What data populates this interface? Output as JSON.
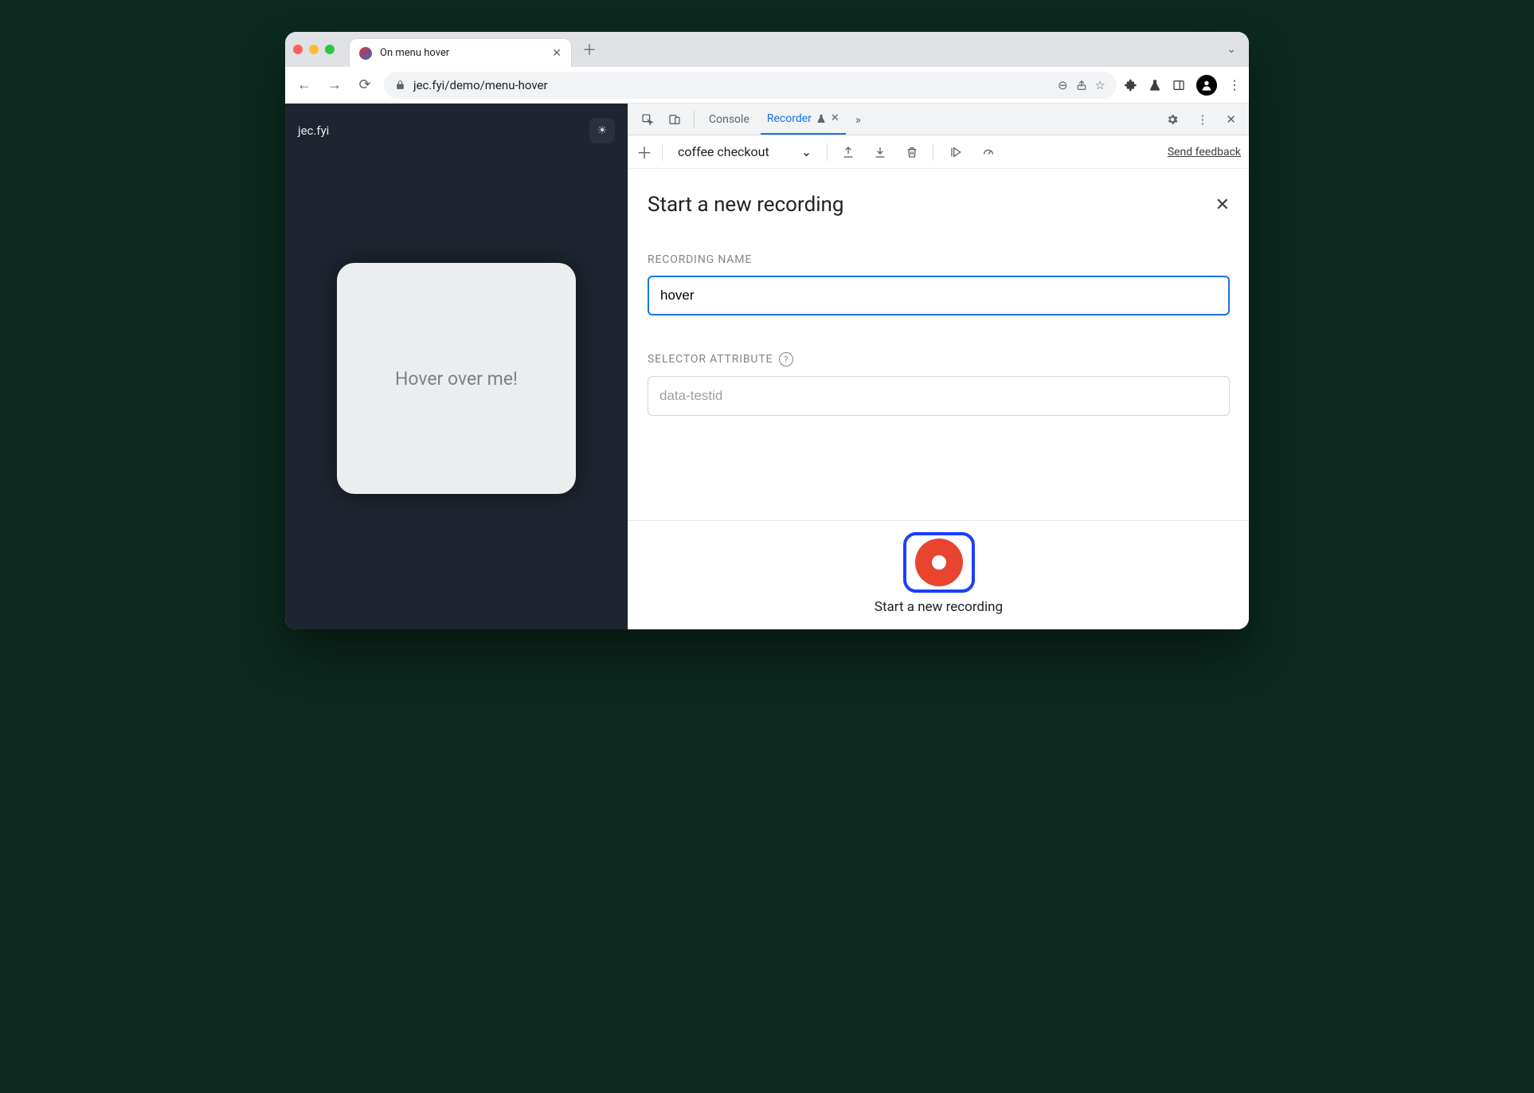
{
  "browser": {
    "tab_title": "On menu hover",
    "url": "jec.fyi/demo/menu-hover"
  },
  "page": {
    "logo_text": "jec.fyi",
    "card_text": "Hover over me!"
  },
  "devtools": {
    "tabs": {
      "console": "Console",
      "recorder": "Recorder"
    }
  },
  "recorder": {
    "selected_recording": "coffee checkout",
    "feedback_label": "Send feedback",
    "form_title": "Start a new recording",
    "recording_name_label": "RECORDING NAME",
    "recording_name_value": "hover",
    "selector_attr_label": "SELECTOR ATTRIBUTE",
    "selector_attr_placeholder": "data-testid",
    "start_button_label": "Start a new recording"
  }
}
